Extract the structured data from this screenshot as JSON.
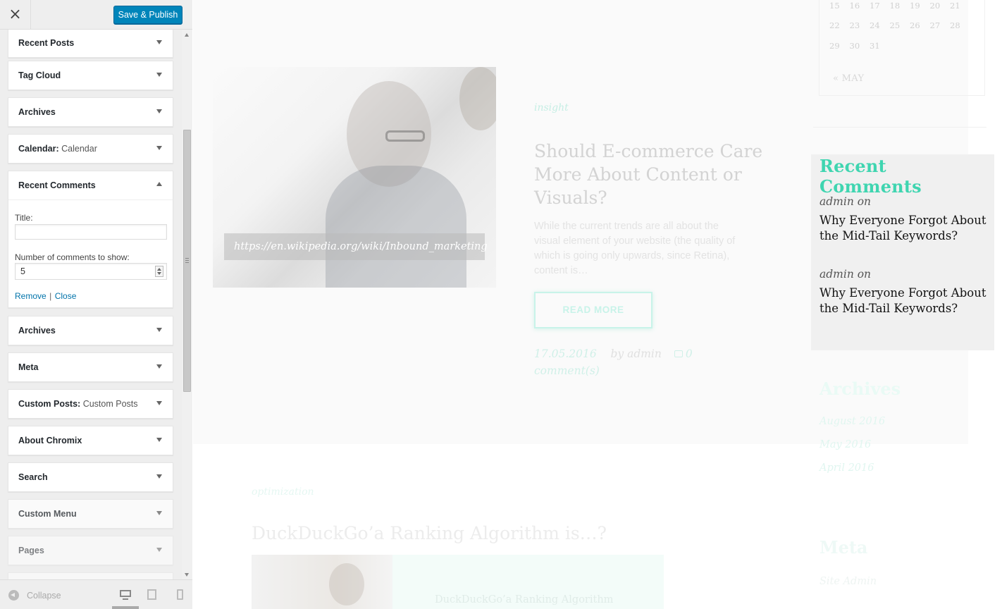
{
  "panel": {
    "close_label": "×",
    "publish_label": "Save & Publish",
    "widgets": [
      {
        "title": "Recent Posts",
        "subtitle": ""
      },
      {
        "title": "Tag Cloud",
        "subtitle": ""
      },
      {
        "title": "Archives",
        "subtitle": ""
      },
      {
        "title": "Calendar:",
        "subtitle": "Calendar"
      },
      {
        "title": "Recent Comments",
        "subtitle": ""
      },
      {
        "title": "Archives",
        "subtitle": ""
      },
      {
        "title": "Meta",
        "subtitle": ""
      },
      {
        "title": "Custom Posts:",
        "subtitle": "Custom Posts"
      },
      {
        "title": "About Chromix",
        "subtitle": ""
      },
      {
        "title": "Search",
        "subtitle": ""
      },
      {
        "title": "Custom Menu",
        "subtitle": ""
      },
      {
        "title": "Pages",
        "subtitle": ""
      }
    ],
    "expanded": {
      "title_label": "Title:",
      "title_value": "",
      "count_label": "Number of comments to show:",
      "count_value": "5",
      "remove_label": "Remove",
      "separator": "|",
      "close_label": "Close"
    },
    "footer": {
      "collapse_label": "Collapse"
    }
  },
  "preview": {
    "calendar": {
      "rows": [
        [
          "15",
          "16",
          "17",
          "18",
          "19",
          "20",
          "21"
        ],
        [
          "22",
          "23",
          "24",
          "25",
          "26",
          "27",
          "28"
        ],
        [
          "29",
          "30",
          "31"
        ]
      ],
      "prev_label": "« MAY"
    },
    "post": {
      "image_caption": "https://en.wikipedia.org/wiki/Inbound_marketing",
      "category": "insight",
      "title": "Should E-commerce Care More About Content or Visuals?",
      "excerpt": "While the current trends are all about the visual element of your website (the quality of which is going only upwards, since Retina), content is…",
      "read_more": "READ MORE",
      "date": "17.05.2016",
      "by_author": "by admin",
      "comments": "0 comment(s)"
    },
    "post2": {
      "category": "optimization",
      "title": "DuckDuckGo’a Ranking Algorithm is…?",
      "image_text": "DuckDuckGo’a Ranking Algorithm"
    },
    "recent_comments": {
      "title": "Recent Comments",
      "items": [
        {
          "author": "admin on",
          "link": "Why Everyone Forgot About the Mid-Tail Keywords?"
        },
        {
          "author": "admin on",
          "link": "Why Everyone Forgot About the Mid-Tail Keywords?"
        }
      ]
    },
    "archives": {
      "title": "Archives",
      "items": [
        "August 2016",
        "May 2016",
        "April 2016"
      ]
    },
    "meta": {
      "title": "Meta",
      "items": [
        "Site Admin"
      ]
    }
  },
  "colors": {
    "accent": "#3fd5b0",
    "publish": "#0085ba",
    "link": "#0073aa"
  }
}
